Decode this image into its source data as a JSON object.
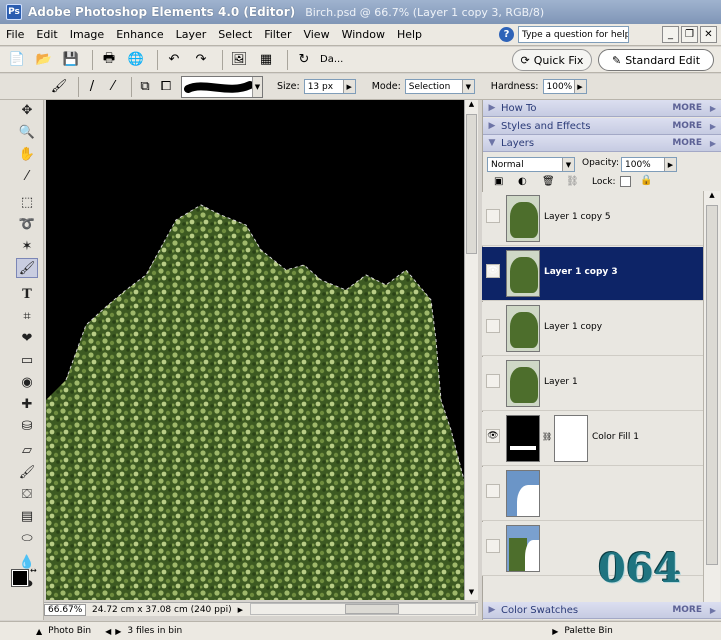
{
  "window": {
    "title_app": "Adobe Photoshop Elements 4.0 (Editor)",
    "title_doc": "Birch.psd @ 66.7% (Layer 1 copy 3, RGB/8)"
  },
  "menu": [
    "File",
    "Edit",
    "Image",
    "Enhance",
    "Layer",
    "Select",
    "Filter",
    "View",
    "Window",
    "Help"
  ],
  "help": {
    "placeholder": "Type a question for help"
  },
  "toolbar": {
    "date_label": "Da...",
    "quick_fix": "Quick Fix",
    "standard_edit": "Standard Edit"
  },
  "options": {
    "size_label": "Size:",
    "size_value": "13 px",
    "mode_label": "Mode:",
    "mode_value": "Selection",
    "hardness_label": "Hardness:",
    "hardness_value": "100%"
  },
  "status": {
    "zoom": "66.67%",
    "dimensions": "24.72 cm x 37.08 cm (240 ppi)"
  },
  "palettes": {
    "howto": "How To",
    "styles": "Styles and Effects",
    "layers": "Layers",
    "swatches": "Color Swatches",
    "more": "MORE"
  },
  "layers_panel": {
    "blend_mode": "Normal",
    "opacity_label": "Opacity:",
    "opacity": "100%",
    "lock_label": "Lock:",
    "rows": [
      {
        "name": "Layer 1 copy 5",
        "visible": false,
        "active": false
      },
      {
        "name": "Layer 1 copy 3",
        "visible": true,
        "active": true
      },
      {
        "name": "Layer 1 copy",
        "visible": false,
        "active": false
      },
      {
        "name": "Layer 1",
        "visible": false,
        "active": false
      },
      {
        "name": "Color Fill 1",
        "visible": true,
        "active": false
      },
      {
        "name": "",
        "visible": false,
        "active": false
      },
      {
        "name": "",
        "visible": false,
        "active": false
      }
    ]
  },
  "bottom": {
    "photo_bin": "Photo Bin",
    "files": "3 files in bin",
    "palette_bin": "Palette Bin"
  },
  "watermark": "064",
  "colors": {
    "accent": "#0d2467",
    "title": "#8ea3c3"
  }
}
